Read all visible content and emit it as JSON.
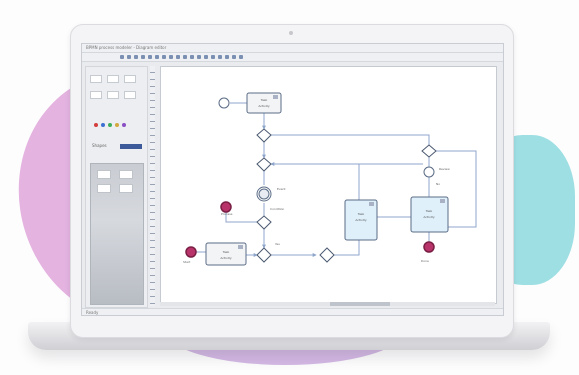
{
  "window": {
    "title_text": "BPMN process modeler - Diagram editor",
    "status_text": "Ready"
  },
  "toolbar": {
    "icons": [
      "new-icon",
      "open-icon",
      "save-icon",
      "print-icon",
      "cut-icon",
      "copy-icon",
      "paste-icon",
      "undo-icon",
      "redo-icon",
      "zoom-in-icon",
      "zoom-out-icon",
      "align-icon",
      "connect-icon",
      "select-icon",
      "text-icon",
      "grid-icon",
      "color-icon",
      "layer-icon"
    ]
  },
  "palette": {
    "tab_label": "Shapes"
  },
  "diagram": {
    "tasks": [
      {
        "title": "Task",
        "subtitle": "Activity"
      },
      {
        "title": "Task",
        "subtitle": "Activity"
      },
      {
        "title": "Task",
        "subtitle": "Activity"
      },
      {
        "title": "Task",
        "subtitle": "Activity"
      }
    ],
    "labels": [
      "Event",
      "Review",
      "Condition",
      "Yes",
      "No",
      "Done",
      "Process",
      "Start"
    ]
  },
  "colors": {
    "flow_line": "#8fa6cc",
    "task_border": "#5a6b85",
    "task_fill": "#f3f4f6",
    "task_header": "#a9b2c4",
    "highlight_fill": "#dff0fb",
    "end_event": "#b8336a",
    "gateway": "#4a5870"
  }
}
